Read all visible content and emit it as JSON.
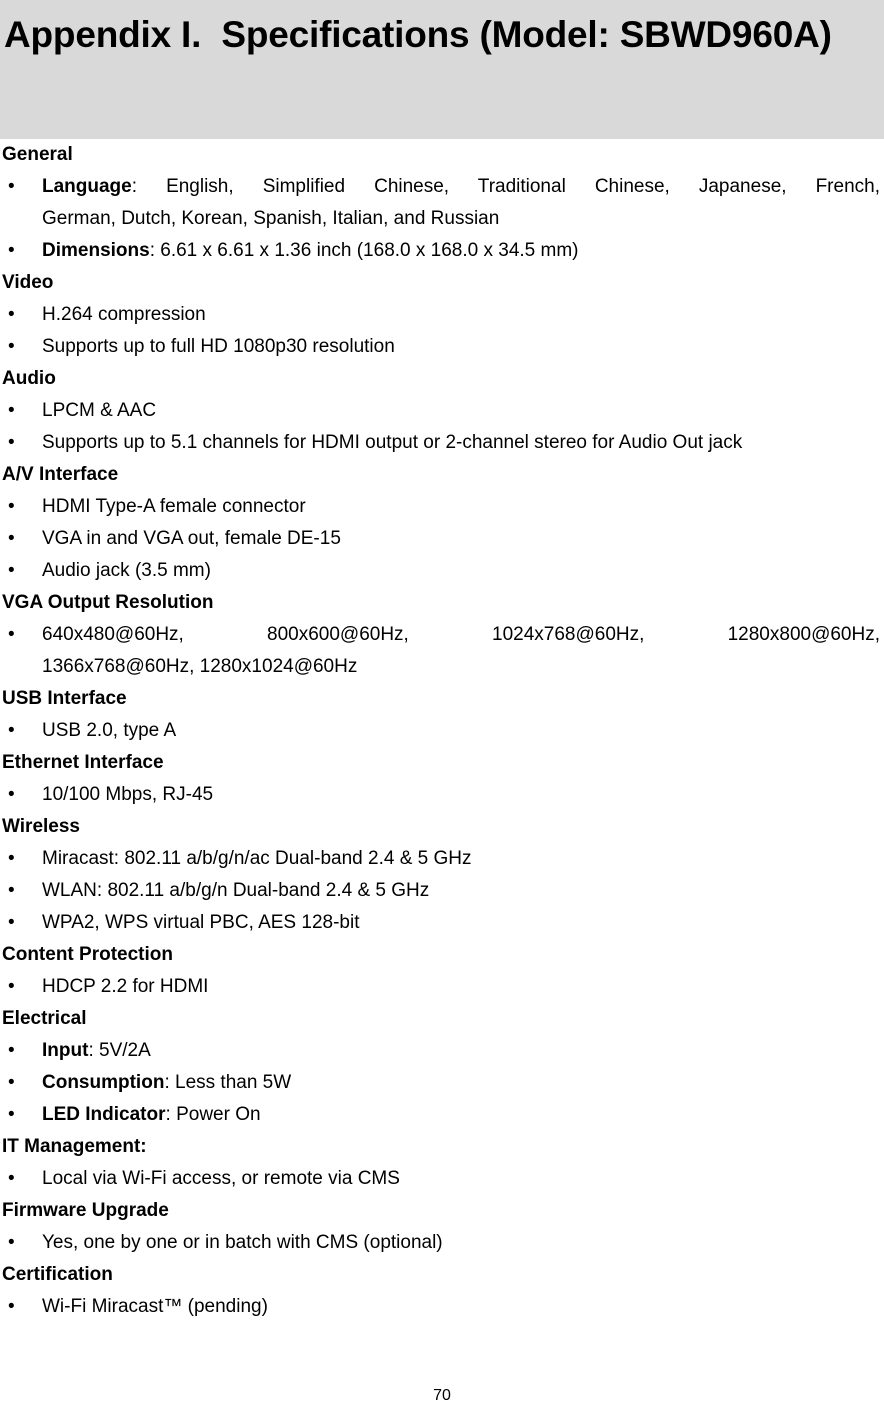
{
  "heading": {
    "text": "Appendix I.  Specifications (Model: SBWD960A)",
    "banner_color": "#d9d9d9"
  },
  "sections": [
    {
      "heading": "General",
      "items": [
        {
          "lead": "Language",
          "separator": ": ",
          "line_a": "English,  Simplified  Chinese,  Traditional  Chinese,  Japanese,  French,",
          "line_b": "German, Dutch, Korean, Spanish, Italian, and Russian",
          "justified": true
        },
        {
          "lead": "Dimensions",
          "separator": ": ",
          "text": "6.61 x 6.61 x 1.36 inch (168.0 x 168.0 x 34.5 mm)"
        }
      ]
    },
    {
      "heading": "Video",
      "items": [
        {
          "text": "H.264 compression"
        },
        {
          "text": "Supports up to full HD 1080p30 resolution"
        }
      ]
    },
    {
      "heading": "Audio",
      "items": [
        {
          "text": "LPCM & AAC"
        },
        {
          "text": "Supports up to 5.1 channels for HDMI output or 2-channel stereo for Audio Out jack"
        }
      ]
    },
    {
      "heading": "A/V Interface",
      "items": [
        {
          "text": "HDMI Type-A female connector"
        },
        {
          "text": "VGA in and VGA out, female DE-15"
        },
        {
          "text": "Audio jack (3.5 mm)"
        }
      ]
    },
    {
      "heading": "VGA Output Resolution",
      "items": [
        {
          "line_a": "640x480@60Hz,  800x600@60Hz,  1024x768@60Hz,  1280x800@60Hz,",
          "line_b": "1366x768@60Hz, 1280x1024@60Hz",
          "justified": true
        }
      ]
    },
    {
      "heading": "USB Interface",
      "items": [
        {
          "text": "USB 2.0, type A"
        }
      ]
    },
    {
      "heading": "Ethernet Interface",
      "items": [
        {
          "text": "10/100 Mbps, RJ-45"
        }
      ]
    },
    {
      "heading": "Wireless",
      "items": [
        {
          "text": "Miracast: 802.11 a/b/g/n/ac Dual-band 2.4 & 5 GHz"
        },
        {
          "text": "WLAN: 802.11 a/b/g/n Dual-band 2.4 & 5 GHz"
        },
        {
          "text": "WPA2, WPS virtual PBC, AES 128-bit"
        }
      ]
    },
    {
      "heading": "Content Protection",
      "items": [
        {
          "text": "HDCP 2.2 for HDMI"
        }
      ]
    },
    {
      "heading": "Electrical",
      "items": [
        {
          "lead": "Input",
          "separator": ": ",
          "text": "5V/2A"
        },
        {
          "lead": "Consumption",
          "separator": ": ",
          "text": "Less than 5W"
        },
        {
          "lead": "LED Indicator",
          "separator": ": ",
          "text": "Power On"
        }
      ]
    },
    {
      "heading": "IT Management:",
      "items": [
        {
          "text": "Local via Wi-Fi access, or remote via CMS"
        }
      ]
    },
    {
      "heading": "Firmware Upgrade",
      "items": [
        {
          "text": "Yes, one by one or in batch with CMS (optional)"
        }
      ]
    },
    {
      "heading": "Certification",
      "items": [
        {
          "text": "Wi-Fi Miracast™ (pending)"
        }
      ]
    }
  ],
  "footer": {
    "page_number": "70"
  },
  "bullet_glyph": "•"
}
